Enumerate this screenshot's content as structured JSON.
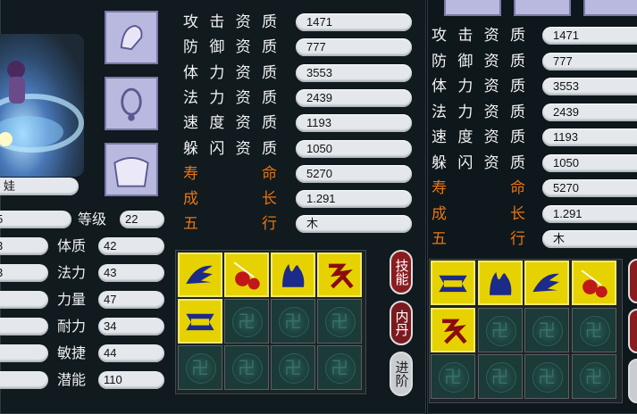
{
  "left": {
    "pet_name_fragment": "娃",
    "level_label": "等级",
    "level_value": "22",
    "left_values": [
      "5",
      "3",
      "3",
      "",
      "",
      "",
      ""
    ],
    "stats": [
      {
        "label": "体质",
        "value": "42"
      },
      {
        "label": "法力",
        "value": "43"
      },
      {
        "label": "力量",
        "value": "47"
      },
      {
        "label": "耐力",
        "value": "34"
      },
      {
        "label": "敏捷",
        "value": "44"
      },
      {
        "label": "潜能",
        "value": "110"
      }
    ],
    "aptitudes": [
      {
        "c": [
          "攻",
          "击",
          "资",
          "质"
        ],
        "value": "1471"
      },
      {
        "c": [
          "防",
          "御",
          "资",
          "质"
        ],
        "value": "777"
      },
      {
        "c": [
          "体",
          "力",
          "资",
          "质"
        ],
        "value": "3553"
      },
      {
        "c": [
          "法",
          "力",
          "资",
          "质"
        ],
        "value": "2439"
      },
      {
        "c": [
          "速",
          "度",
          "资",
          "质"
        ],
        "value": "1193"
      },
      {
        "c": [
          "躲",
          "闪",
          "资",
          "质"
        ],
        "value": "1050"
      }
    ],
    "extra": [
      {
        "c": [
          "寿",
          "命"
        ],
        "value": "5270"
      },
      {
        "c": [
          "成",
          "长"
        ],
        "value": "1.291"
      },
      {
        "c": [
          "五",
          "行"
        ],
        "value": "木"
      }
    ],
    "buttons": {
      "skills": "技能",
      "inner": "内丹",
      "advance": "进阶"
    }
  },
  "right": {
    "aptitudes": [
      {
        "c": [
          "攻",
          "击",
          "资",
          "质"
        ],
        "value": "1471"
      },
      {
        "c": [
          "防",
          "御",
          "资",
          "质"
        ],
        "value": "777"
      },
      {
        "c": [
          "体",
          "力",
          "资",
          "质"
        ],
        "value": "3553"
      },
      {
        "c": [
          "法",
          "力",
          "资",
          "质"
        ],
        "value": "2439"
      },
      {
        "c": [
          "速",
          "度",
          "资",
          "质"
        ],
        "value": "1193"
      },
      {
        "c": [
          "躲",
          "闪",
          "资",
          "质"
        ],
        "value": "1050"
      }
    ],
    "extra": [
      {
        "c": [
          "寿",
          "命"
        ],
        "value": "5270"
      },
      {
        "c": [
          "成",
          "长"
        ],
        "value": "1.291"
      },
      {
        "c": [
          "五",
          "行"
        ],
        "value": "木"
      }
    ]
  },
  "colors": {
    "accent_orange": "#e87414",
    "skill_gold": "#d8c400",
    "button_red": "#8a1c20"
  }
}
